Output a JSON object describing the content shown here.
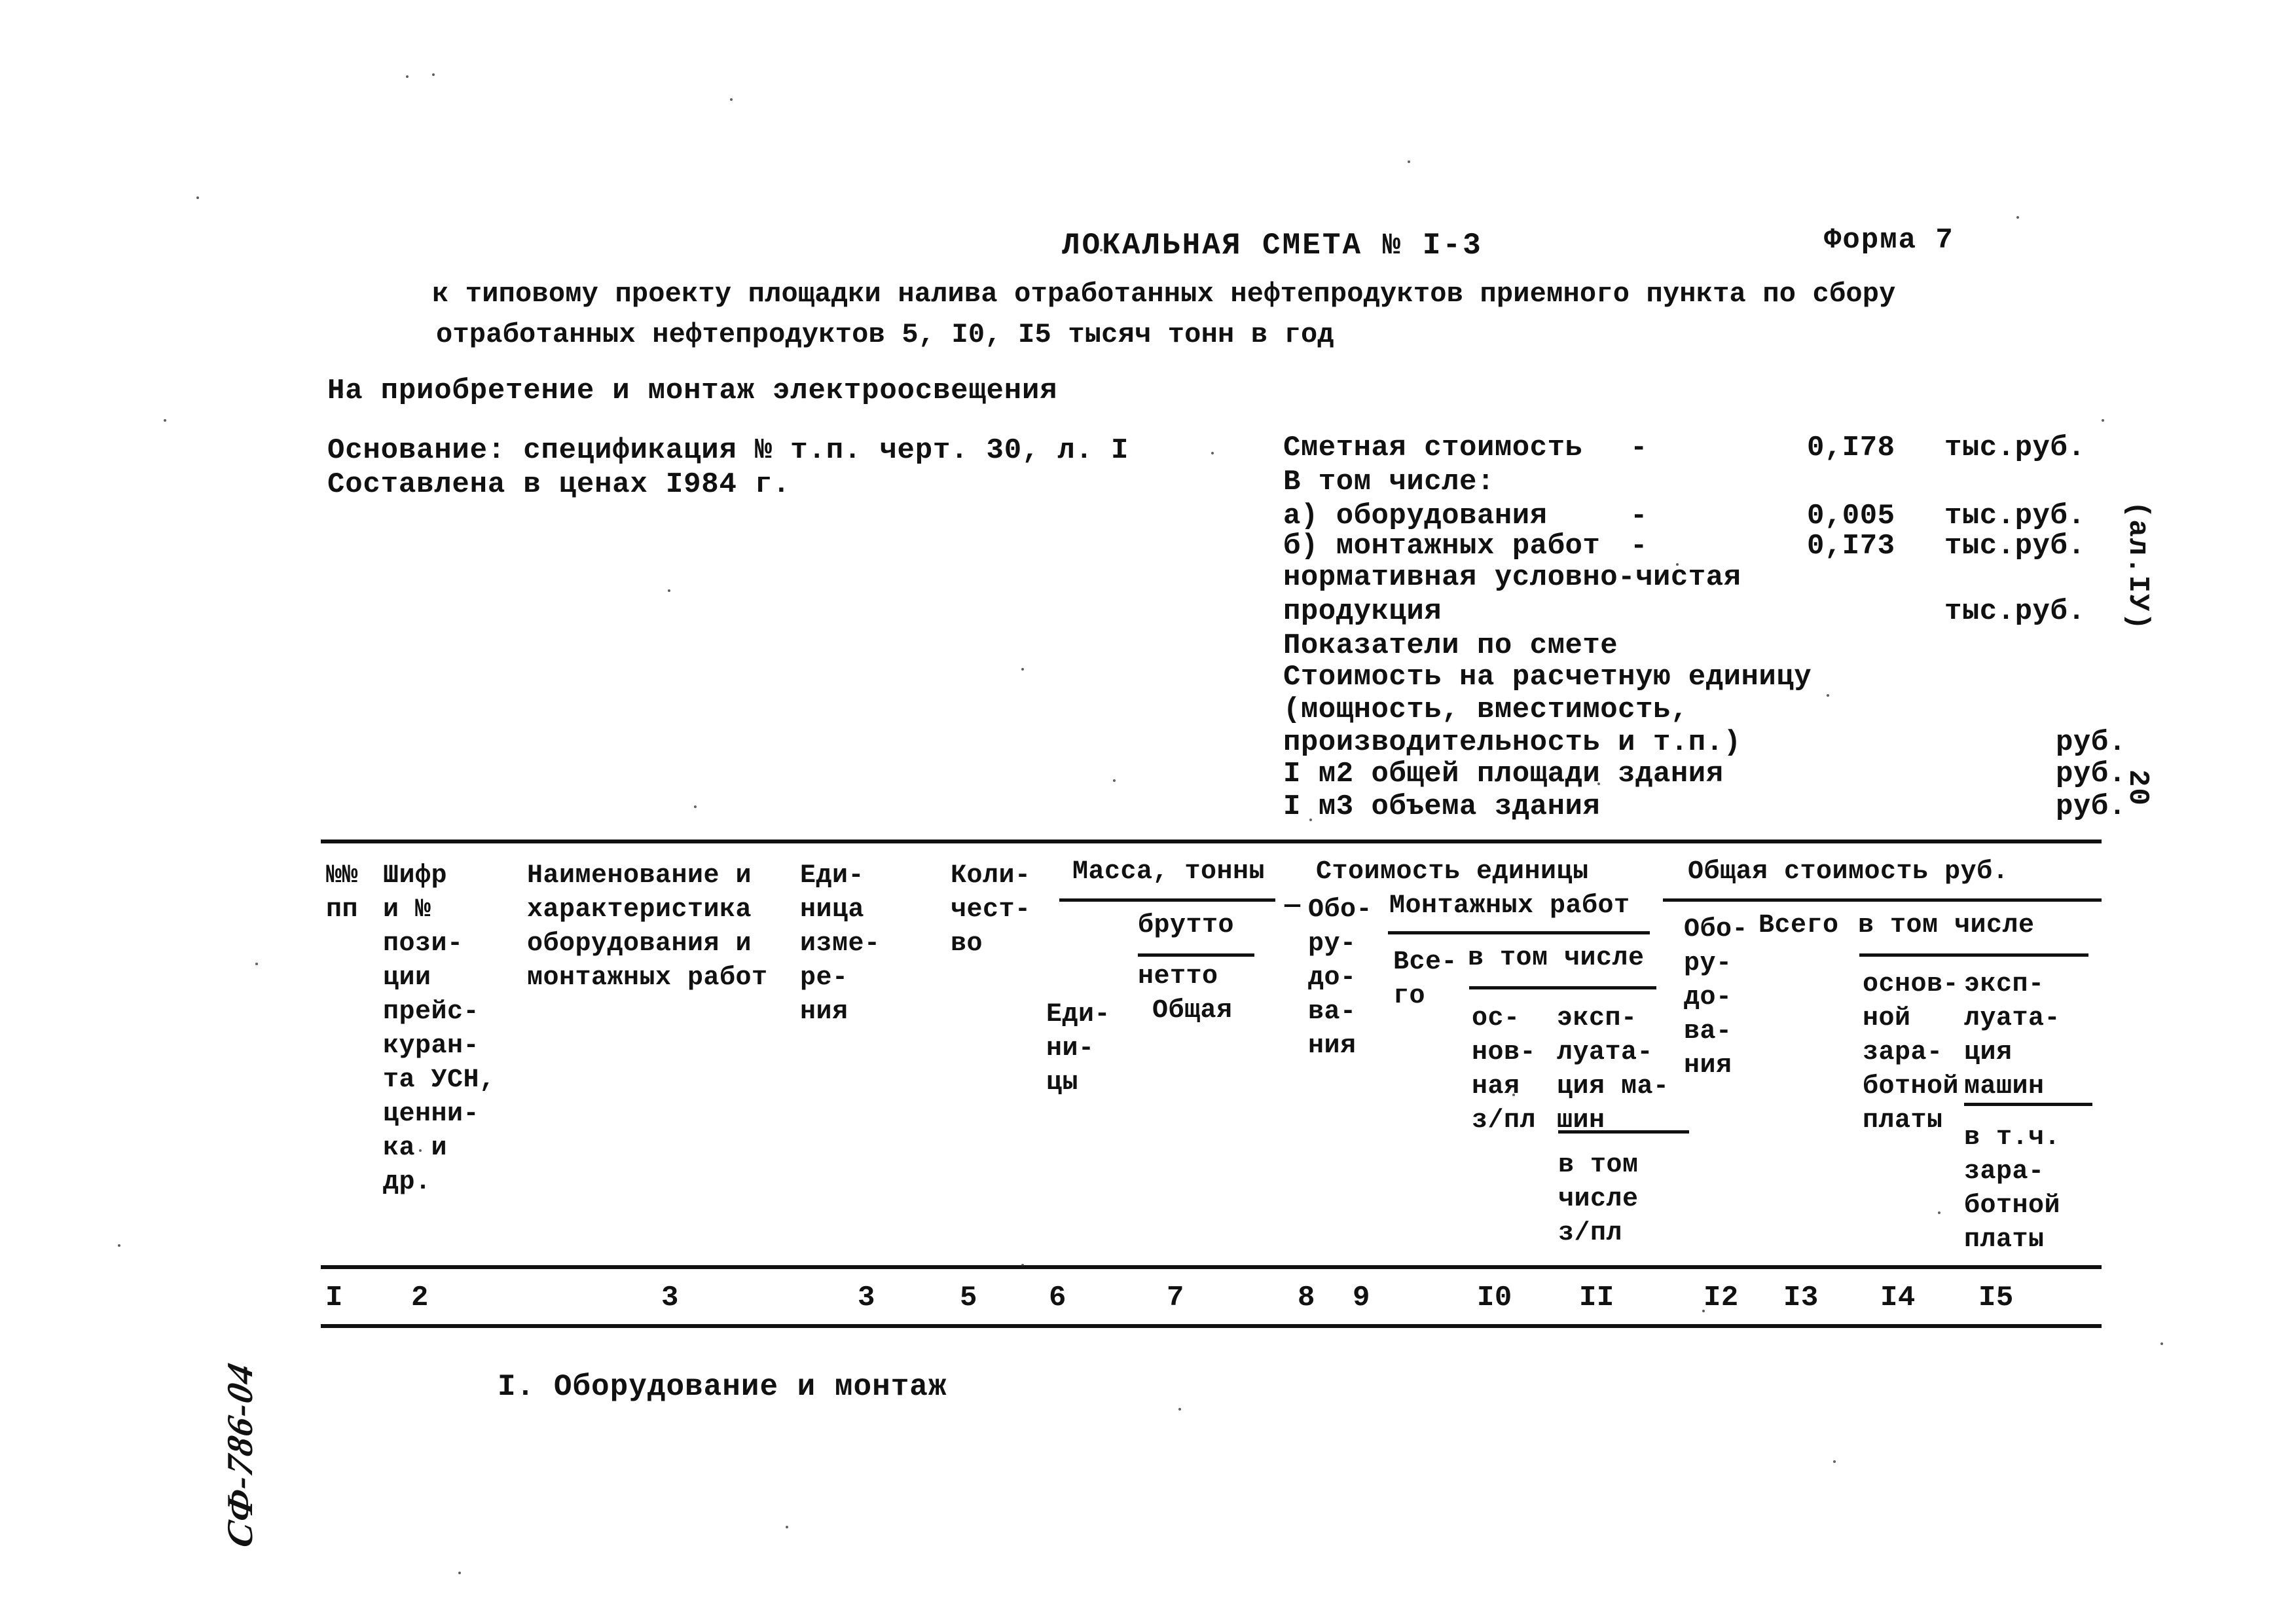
{
  "document": {
    "title": "ЛОКАЛЬНАЯ СМЕТА № I-3",
    "form_label": "Форма 7",
    "subtitle_line1": "к типовому проекту площадки налива отработанных нефтепродуктов приемного пункта по сбору",
    "subtitle_line2": "отработанных нефтепродуктов 5, I0, I5 тысяч тонн в год",
    "purpose": "На приобретение и монтаж электроосвещения",
    "basis_line1": "Основание: спецификация № т.п. черт. 30, л. I",
    "basis_line2": "Составлена в ценах I984 г.",
    "margin_vertical": "(ал.IУ)",
    "page_number": "20",
    "archive_mark": "СФ-786-04"
  },
  "summary": {
    "rows": [
      {
        "label": "Сметная стоимость",
        "dash": "-",
        "value": "0,I78",
        "unit": "тыс.руб."
      },
      {
        "label": "В том числе:",
        "dash": "",
        "value": "",
        "unit": ""
      },
      {
        "label": "а) оборудования",
        "dash": "-",
        "value": "0,005",
        "unit": "тыс.руб."
      },
      {
        "label": "б) монтажных работ",
        "dash": "-",
        "value": "0,I73",
        "unit": "тыс.руб."
      },
      {
        "label": "нормативная условно-чистая",
        "dash": "",
        "value": "",
        "unit": ""
      },
      {
        "label": "продукция",
        "dash": "",
        "value": "",
        "unit": "тыс.руб."
      },
      {
        "label": "Показатели по смете",
        "dash": "",
        "value": "",
        "unit": ""
      },
      {
        "label": "Стоимость на расчетную единицу",
        "dash": "",
        "value": "",
        "unit": ""
      },
      {
        "label": "(мощность, вместимость,",
        "dash": "",
        "value": "",
        "unit": ""
      },
      {
        "label": "производительность и т.п.)",
        "dash": "",
        "value": "",
        "unit": "руб."
      },
      {
        "label": "I м2 общей площади здания",
        "dash": "",
        "value": "",
        "unit": "руб."
      },
      {
        "label": "I м3 объема здания",
        "dash": "",
        "value": "",
        "unit": "руб."
      }
    ]
  },
  "table": {
    "headers": {
      "col1": "№№\nпп",
      "col2": "Шифр\nи №\nпози-\nции\nпрейс-\nкуран-\nта УСН,\nценни-\nка и\nдр.",
      "col3": "Наименование и\nхарактеристика\nоборудования и\nмонтажных работ",
      "col4": "Еди-\nница\nизме-\nре-\nния",
      "col5": "Коли-\nчест-\nво",
      "mass_group": "Масса, тонны",
      "mass_brutto": "брутто",
      "mass_netto": "нетто",
      "mass_unit": "Еди-\nни-\nцы",
      "mass_total": "Общая",
      "unitcost_group": "Стоимость единицы",
      "unitcost_equip": "Обо-\nру-\nдо-\nва-\nния",
      "unitcost_mount": "Монтажных работ",
      "unitcost_all": "Все-\nго",
      "unitcost_incl": "в том числе",
      "unitcost_base": "ос-\nнов-\nная\nз/пл",
      "unitcost_machines": "экcп-\nлуата-\nция ма-\nшин",
      "unitcost_incl2": "в том\nчисле\nз/пл",
      "total_group": "Общая стоимость руб.",
      "total_equip": "Обо-\nру-\nдо-\nва-\nния",
      "total_all": "Всего",
      "total_incl": "в том числе",
      "total_base": "основ-\nной\nзара-\nботной\nплаты",
      "total_machines": "эксп-\nлуата-\nция\nмашин",
      "total_incl2": "в т.ч.\nзара-\nботной\nплаты"
    },
    "column_numbers": [
      "I",
      "2",
      "3",
      "3",
      "5",
      "6",
      "7",
      "8",
      "9",
      "I0",
      "II",
      "I2",
      "I3",
      "I4",
      "I5"
    ],
    "section_heading": "I. Оборудование и монтаж"
  }
}
